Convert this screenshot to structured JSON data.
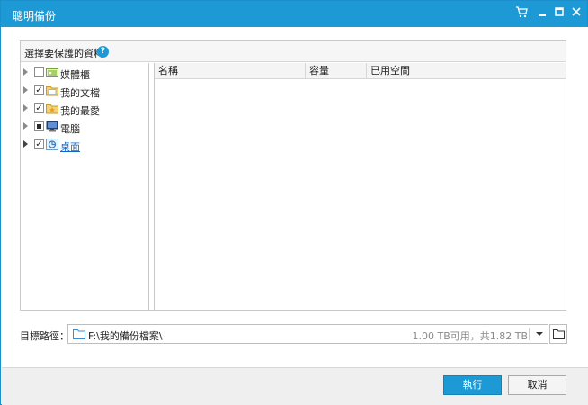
{
  "window": {
    "title": "聰明備份",
    "controls": [
      {
        "name": "cart-icon",
        "glyph": "🛒"
      },
      {
        "name": "minimize-icon",
        "glyph": "▁"
      },
      {
        "name": "maximize-icon",
        "glyph": "□"
      },
      {
        "name": "close-icon",
        "glyph": "✕"
      }
    ]
  },
  "panel": {
    "header_label": "選擇要保護的資料",
    "help_glyph": "?"
  },
  "tree": {
    "items": [
      {
        "label": "媒體櫃",
        "checked": false,
        "partial": false,
        "icon": "media-library-icon",
        "link": false
      },
      {
        "label": "我的文檔",
        "checked": true,
        "partial": false,
        "icon": "documents-folder-icon",
        "link": false
      },
      {
        "label": "我的最愛",
        "checked": true,
        "partial": false,
        "icon": "favorites-folder-icon",
        "link": false
      },
      {
        "label": "電腦",
        "checked": false,
        "partial": true,
        "icon": "computer-icon",
        "link": false
      },
      {
        "label": "桌面",
        "checked": true,
        "partial": false,
        "icon": "desktop-icon",
        "link": true
      }
    ]
  },
  "list": {
    "columns": [
      "名稱",
      "容量",
      "已用空間"
    ]
  },
  "destination": {
    "label": "目標路徑：",
    "path": "F:\\我的備份檔案\\",
    "space": "1.00 TB可用，共1.82 TB"
  },
  "footer": {
    "ok_label": "執行",
    "cancel_label": "取消"
  },
  "colors": {
    "accent": "#1d9ad6",
    "link": "#1566c2"
  }
}
